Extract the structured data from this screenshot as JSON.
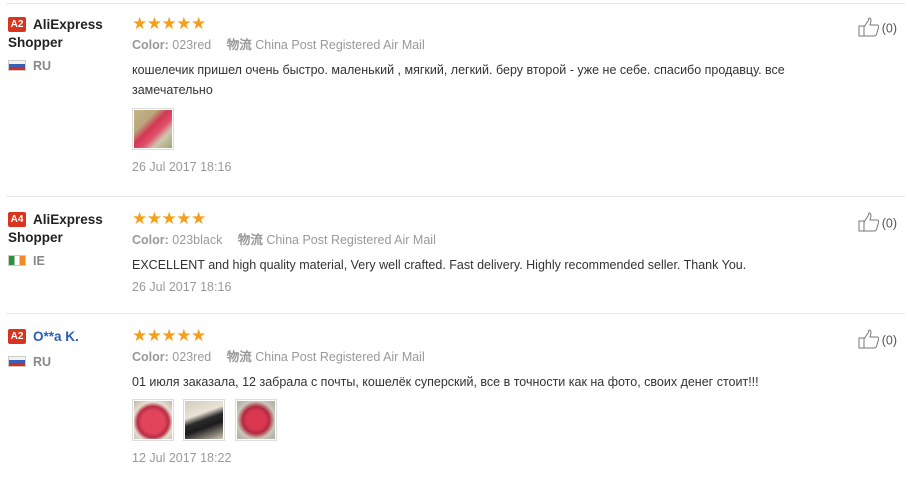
{
  "reviews": [
    {
      "badge": "A2",
      "user_line1": "AliExpress",
      "user_line2": "Shopper",
      "user_is_link": false,
      "flag": "ru",
      "country": "RU",
      "stars": "★★★★★",
      "color_label": "Color:",
      "color_value": "023red",
      "ship_icon": "物流",
      "shipping": "China Post Registered Air Mail",
      "text": "кошелечик пришел очень быстро. маленький , мягкий, легкий. беру второй - уже не себе. спасибо продавцу. все замечательно",
      "photos": [
        "img-a"
      ],
      "date": "26 Jul 2017 18:16",
      "helpful": "(0)"
    },
    {
      "badge": "A4",
      "user_line1": "AliExpress",
      "user_line2": "Shopper",
      "user_is_link": false,
      "flag": "ie",
      "country": "IE",
      "stars": "★★★★★",
      "color_label": "Color:",
      "color_value": "023black",
      "ship_icon": "物流",
      "shipping": "China Post Registered Air Mail",
      "text": "EXCELLENT and high quality material, Very well crafted. Fast delivery. Highly recommended seller. Thank You.",
      "photos": [],
      "date": "26 Jul 2017 18:16",
      "helpful": "(0)"
    },
    {
      "badge": "A2",
      "user_line1": "O**a K.",
      "user_line2": "",
      "user_is_link": true,
      "flag": "ru",
      "country": "RU",
      "stars": "★★★★★",
      "color_label": "Color:",
      "color_value": "023red",
      "ship_icon": "物流",
      "shipping": "China Post Registered Air Mail",
      "text": "01 июля заказала, 12 забрала с почты, кошелёк суперский, все в точности как на фото, своих денег стоит!!!",
      "photos": [
        "img-b",
        "img-c",
        "img-d"
      ],
      "date": "12 Jul 2017 18:22",
      "helpful": "(0)"
    }
  ]
}
